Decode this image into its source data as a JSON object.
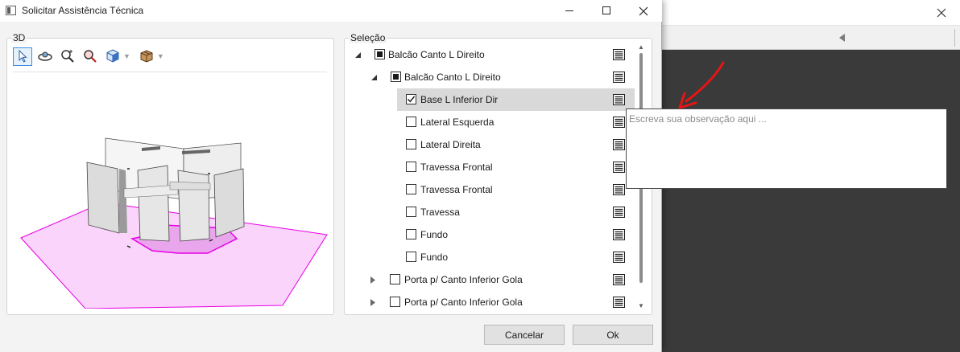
{
  "dialog": {
    "title": "Solicitar Assistência Técnica",
    "minimize_icon": "minimize-icon",
    "maximize_icon": "maximize-icon",
    "close_icon": "close-icon"
  },
  "view3d": {
    "group_label": "3D",
    "toolbar": [
      {
        "icon": "select-arrow-icon",
        "active": true
      },
      {
        "icon": "orbit-icon",
        "active": false
      },
      {
        "icon": "zoom-extents-icon",
        "active": false
      },
      {
        "icon": "zoom-icon",
        "active": false
      },
      {
        "icon": "view-cube-icon",
        "active": false,
        "dropdown": true
      },
      {
        "icon": "box-icon",
        "active": false,
        "dropdown": true
      }
    ]
  },
  "selection": {
    "group_label": "Seleção",
    "items": [
      {
        "label": "Balcão Canto L Direito",
        "level": 0,
        "expander": "expanded",
        "check": "partial"
      },
      {
        "label": "Balcão Canto L Direito",
        "level": 1,
        "expander": "expanded",
        "check": "partial"
      },
      {
        "label": "Base L Inferior Dir",
        "level": 2,
        "expander": "none",
        "check": "checked",
        "selected": true
      },
      {
        "label": "Lateral Esquerda",
        "level": 2,
        "expander": "none",
        "check": "unchecked"
      },
      {
        "label": "Lateral Direita",
        "level": 2,
        "expander": "none",
        "check": "unchecked"
      },
      {
        "label": "Travessa Frontal",
        "level": 2,
        "expander": "none",
        "check": "unchecked"
      },
      {
        "label": "Travessa Frontal",
        "level": 2,
        "expander": "none",
        "check": "unchecked"
      },
      {
        "label": "Travessa",
        "level": 2,
        "expander": "none",
        "check": "unchecked"
      },
      {
        "label": "Fundo",
        "level": 2,
        "expander": "none",
        "check": "unchecked"
      },
      {
        "label": "Fundo",
        "level": 2,
        "expander": "none",
        "check": "unchecked"
      },
      {
        "label": "Porta p/ Canto Inferior Gola",
        "level": 0,
        "expander": "collapsed",
        "check": "unchecked"
      },
      {
        "label": "Porta p/ Canto Inferior Gola",
        "level": 0,
        "expander": "collapsed",
        "check": "unchecked"
      }
    ]
  },
  "observation": {
    "placeholder": "Escreva sua observação aqui ...",
    "value": ""
  },
  "buttons": {
    "cancel": "Cancelar",
    "ok": "Ok"
  },
  "colors": {
    "accent": "#3c8ee0",
    "annotation_arrow": "#e81414",
    "floor_pink": "#fbd4fb",
    "floor_magenta": "#e600e6"
  }
}
